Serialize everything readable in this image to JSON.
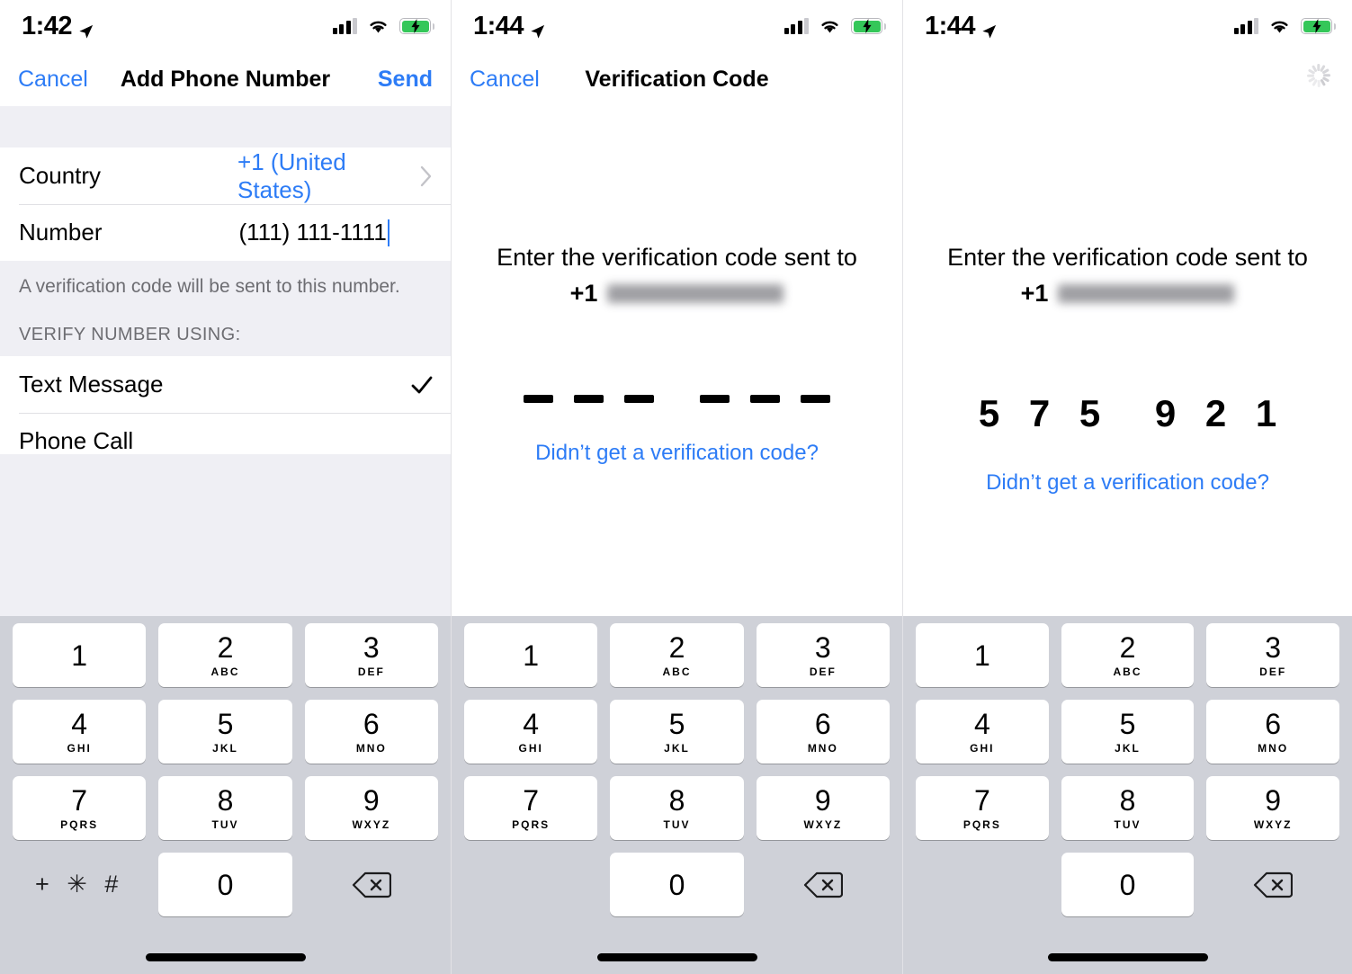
{
  "panels": [
    {
      "status": {
        "time": "1:42",
        "location_icon": "location-arrow-icon",
        "signal_icon": "cellular-signal-icon",
        "wifi_icon": "wifi-icon",
        "battery_icon": "battery-charging-icon"
      },
      "nav": {
        "left_label": "Cancel",
        "title": "Add Phone Number",
        "right_label": "Send"
      },
      "form": {
        "country": {
          "label": "Country",
          "value": "+1 (United States)",
          "disclosure_icon": "chevron-right-icon"
        },
        "number": {
          "label": "Number",
          "value": "(111) 111-1111"
        },
        "footnote": "A verification code will be sent to this number.",
        "section_header": "VERIFY NUMBER USING:",
        "options": [
          {
            "label": "Text Message",
            "selected": true,
            "check_icon": "checkmark-icon"
          },
          {
            "label": "Phone Call",
            "selected": false
          }
        ]
      },
      "keypad": {
        "has_symbols_key": true,
        "symbols_label": "+ ✳ #",
        "backspace_icon": "backspace-icon"
      }
    },
    {
      "status": {
        "time": "1:44",
        "location_icon": "location-arrow-icon",
        "signal_icon": "cellular-signal-icon",
        "wifi_icon": "wifi-icon",
        "battery_icon": "battery-charging-icon"
      },
      "nav": {
        "left_label": "Cancel",
        "title": "Verification Code",
        "right_label": ""
      },
      "verification": {
        "prompt_line1": "Enter the verification code sent to",
        "country_code": "+1",
        "phone_redacted": true,
        "code_digits": [
          "–",
          "–",
          "–",
          "–",
          "–",
          "–"
        ],
        "code_entered": false,
        "resend_label": "Didn’t get a verification code?"
      },
      "keypad": {
        "has_symbols_key": false,
        "symbols_label": "",
        "backspace_icon": "backspace-icon"
      }
    },
    {
      "status": {
        "time": "1:44",
        "location_icon": "location-arrow-icon",
        "signal_icon": "cellular-signal-icon",
        "wifi_icon": "wifi-icon",
        "battery_icon": "battery-charging-icon"
      },
      "nav": {
        "left_label": "",
        "title": "",
        "right_label": "",
        "spinner_icon": "activity-indicator-icon"
      },
      "verification": {
        "prompt_line1": "Enter the verification code sent to",
        "country_code": "+1",
        "phone_redacted": true,
        "code_digits": [
          "5",
          "7",
          "5",
          "9",
          "2",
          "1"
        ],
        "code_entered": true,
        "resend_label": "Didn’t get a verification code?"
      },
      "keypad": {
        "has_symbols_key": false,
        "symbols_label": "",
        "backspace_icon": "backspace-icon"
      }
    }
  ],
  "keypad_keys": [
    {
      "num": "1",
      "letters": ""
    },
    {
      "num": "2",
      "letters": "ABC"
    },
    {
      "num": "3",
      "letters": "DEF"
    },
    {
      "num": "4",
      "letters": "GHI"
    },
    {
      "num": "5",
      "letters": "JKL"
    },
    {
      "num": "6",
      "letters": "MNO"
    },
    {
      "num": "7",
      "letters": "PQRS"
    },
    {
      "num": "8",
      "letters": "TUV"
    },
    {
      "num": "9",
      "letters": "WXYZ"
    },
    {
      "num": "0",
      "letters": ""
    }
  ],
  "colors": {
    "accent_blue": "#2d7cf6",
    "grouped_bg": "#efeff4",
    "keypad_bg": "#cfd1d8",
    "key_bg": "#ffffff",
    "battery_green": "#34c759",
    "secondary_text": "#6d6d72"
  }
}
